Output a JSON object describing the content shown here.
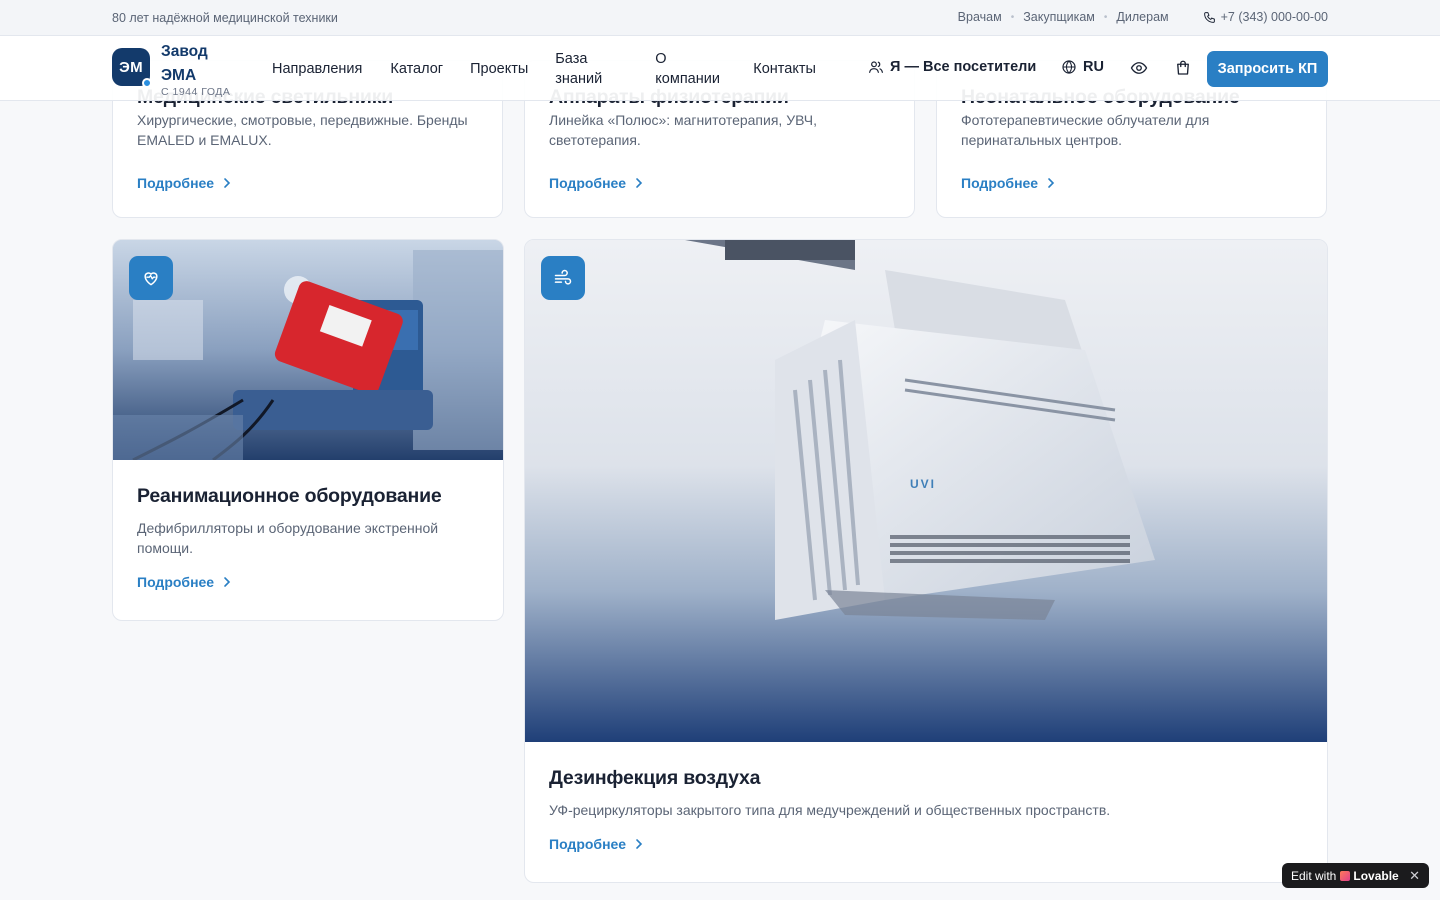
{
  "topbar": {
    "tagline": "80 лет надёжной медицинской техники",
    "links": [
      "Врачам",
      "Закупщикам",
      "Дилерам"
    ],
    "phone": "+7 (343) 000-00-00"
  },
  "header": {
    "logo_text": "ЭМ",
    "brand_name": "Завод ЭМА",
    "brand_since": "С 1944 ГОДА",
    "nav": [
      "Направления",
      "Каталог",
      "Проекты",
      "База знаний",
      "О компании",
      "Контакты"
    ],
    "visitor_label": "Я — Все посетители",
    "language": "RU",
    "cta_label": "Запросить КП"
  },
  "cards": {
    "lights": {
      "title": "Медицинские светильники",
      "desc": "Хирургические, смотровые, передвижные. Бренды EMALED и EMALUX.",
      "more": "Подробнее"
    },
    "physio": {
      "title": "Аппараты физиотерапии",
      "desc": "Линейка «Полюс»: магнитотерапия, УВЧ, светотерапия.",
      "more": "Подробнее"
    },
    "neonatal": {
      "title": "Неонатальное оборудование",
      "desc": "Фототерапевтические облучатели для перинатальных центров.",
      "more": "Подробнее"
    },
    "resus": {
      "title": "Реанимационное оборудование",
      "desc": "Дефибрилляторы и оборудование экстренной помощи.",
      "more": "Подробнее",
      "icon": "heart-pulse-icon"
    },
    "air": {
      "title": "Дезинфекция воздуха",
      "desc": "УФ-рециркуляторы закрытого типа для медучреждений и общественных пространств.",
      "more": "Подробнее",
      "icon": "wind-icon",
      "device_label": "UVI"
    }
  },
  "edit_badge": {
    "prefix": "Edit with",
    "brand": "Lovable"
  },
  "colors": {
    "primary": "#2a7fc4",
    "navy": "#133a6b",
    "text": "#1a2233",
    "muted": "#5b6576"
  }
}
